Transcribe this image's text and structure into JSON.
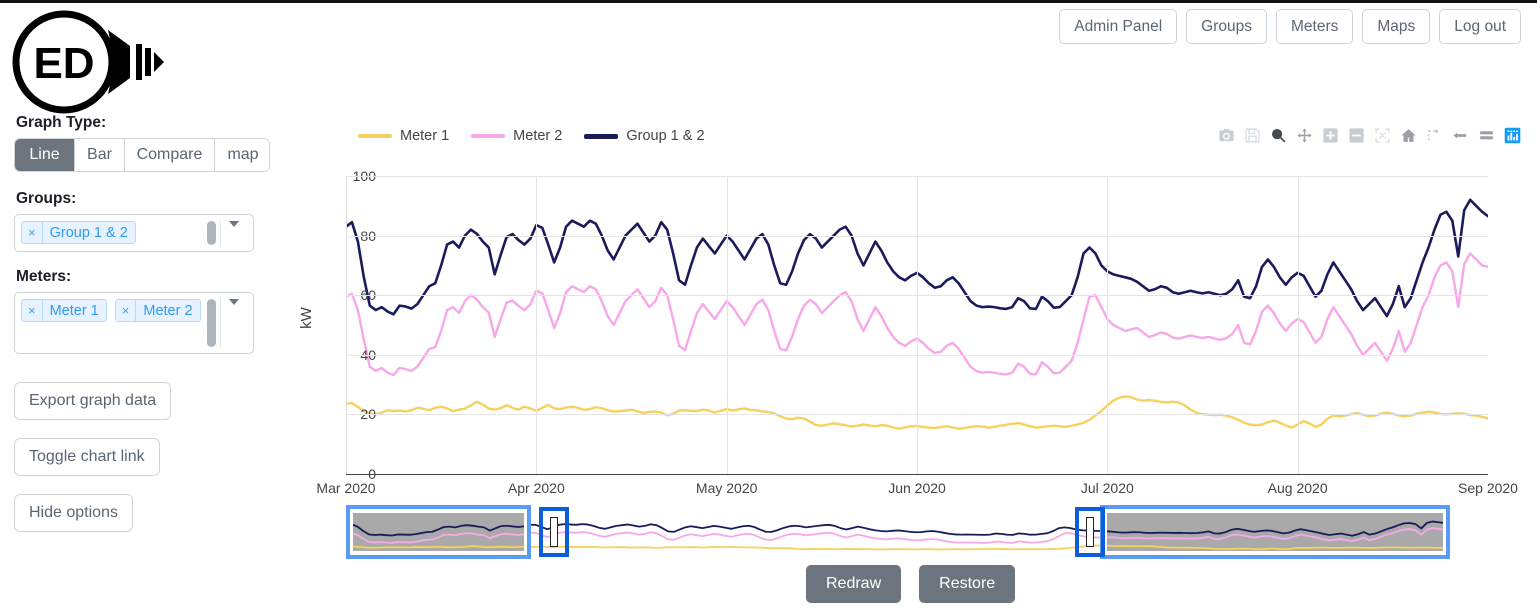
{
  "nav": {
    "buttons": [
      {
        "label": "Admin Panel",
        "name": "admin-panel"
      },
      {
        "label": "Groups",
        "name": "groups"
      },
      {
        "label": "Meters",
        "name": "meters"
      },
      {
        "label": "Maps",
        "name": "maps"
      },
      {
        "label": "Log out",
        "name": "log-out"
      }
    ]
  },
  "logo": {
    "text": "ED"
  },
  "sidebar": {
    "graph_type_label": "Graph Type:",
    "graph_types": [
      {
        "label": "Line",
        "active": true
      },
      {
        "label": "Bar",
        "active": false
      },
      {
        "label": "Compare",
        "active": false
      },
      {
        "label": "map",
        "active": false
      }
    ],
    "groups_label": "Groups:",
    "groups_selected": [
      {
        "label": "Group 1 & 2",
        "remove": "×"
      }
    ],
    "meters_label": "Meters:",
    "meters_selected": [
      {
        "label": "Meter 1",
        "remove": "×"
      },
      {
        "label": "Meter 2",
        "remove": "×"
      }
    ],
    "buttons": [
      {
        "label": "Export graph data",
        "name": "export-graph-data"
      },
      {
        "label": "Toggle chart link",
        "name": "toggle-chart-link"
      },
      {
        "label": "Hide options",
        "name": "hide-options"
      }
    ]
  },
  "modebar": {
    "items": [
      {
        "name": "camera-icon",
        "title": "Download plot as a png",
        "active": false
      },
      {
        "name": "save-disk-icon",
        "title": "Edit in Chart Studio",
        "active": false
      },
      {
        "name": "zoom-icon",
        "title": "Zoom",
        "active": false
      },
      {
        "name": "pan-icon",
        "title": "Pan",
        "active": false
      },
      {
        "name": "zoom-in-icon",
        "title": "Zoom in",
        "active": false
      },
      {
        "name": "zoom-out-icon",
        "title": "Zoom out",
        "active": false
      },
      {
        "name": "autoscale-icon",
        "title": "Autoscale",
        "active": false
      },
      {
        "name": "home-reset-icon",
        "title": "Reset axes",
        "active": false
      },
      {
        "name": "spike-lines-icon",
        "title": "Toggle Spike Lines",
        "active": false
      },
      {
        "name": "hover-closest-icon",
        "title": "Show closest data on hover",
        "active": false
      },
      {
        "name": "hover-compare-icon",
        "title": "Compare data on hover",
        "active": false
      },
      {
        "name": "plotly-logo-icon",
        "title": "Produced with Plotly",
        "active": true
      }
    ],
    "active_color": "#119dff"
  },
  "bottom_buttons": [
    {
      "label": "Redraw",
      "name": "redraw-button"
    },
    {
      "label": "Restore",
      "name": "restore-button"
    }
  ],
  "rangeslider": {
    "selections": [
      {
        "name": "range-selection-left",
        "left_pct": 0.0,
        "width_pct": 16.8
      },
      {
        "name": "range-selection-right",
        "left_pct": 68.3,
        "width_pct": 31.7
      }
    ],
    "handles": [
      {
        "name": "range-handle-left",
        "left_pct": 17.5
      },
      {
        "name": "range-handle-right",
        "left_pct": 66.0
      }
    ],
    "border_color": "#5b9bf8",
    "handle_color": "#0b5ed7",
    "band_color": "#a9a9a9"
  },
  "chart_data": {
    "type": "line",
    "title": "",
    "xlabel": "",
    "ylabel": "kW",
    "ylim": [
      0,
      100
    ],
    "yticks": [
      0,
      20,
      40,
      60,
      80,
      100
    ],
    "xticks": [
      "Mar 2020",
      "Apr 2020",
      "May 2020",
      "Jun 2020",
      "Jul 2020",
      "Aug 2020",
      "Sep 2020"
    ],
    "grid": true,
    "legend_position": "top-left",
    "series": [
      {
        "name": "Meter 1",
        "color": "#f7d060",
        "values": [
          23.5,
          23.8,
          22.5,
          21.2,
          20.3,
          20.0,
          20.6,
          21.4,
          21.1,
          21.3,
          21.0,
          21.4,
          22.2,
          21.9,
          21.4,
          22.2,
          22.6,
          22.0,
          21.1,
          21.6,
          21.9,
          23.0,
          24.2,
          23.3,
          22.0,
          21.6,
          22.1,
          23.1,
          22.2,
          21.6,
          22.6,
          22.0,
          21.2,
          22.2,
          23.2,
          22.0,
          21.8,
          22.3,
          22.6,
          22.2,
          21.5,
          21.8,
          22.4,
          22.1,
          21.4,
          21.0,
          21.1,
          21.3,
          21.6,
          21.0,
          20.5,
          20.8,
          21.0,
          20.6,
          19.7,
          20.2,
          21.3,
          21.4,
          21.2,
          21.1,
          21.6,
          21.3,
          20.6,
          21.2,
          21.8,
          21.3,
          21.7,
          22.0,
          21.5,
          21.4,
          21.0,
          20.8,
          20.3,
          19.4,
          18.6,
          18.4,
          18.9,
          18.6,
          17.6,
          16.4,
          16.2,
          16.6,
          17.0,
          16.7,
          16.4,
          15.9,
          16.2,
          16.6,
          16.3,
          16.0,
          16.4,
          16.2,
          15.6,
          15.2,
          15.6,
          16.0,
          16.1,
          15.8,
          15.6,
          15.4,
          15.8,
          16.0,
          15.6,
          15.2,
          15.4,
          15.8,
          16.0,
          15.9,
          15.6,
          15.8,
          16.2,
          16.5,
          16.8,
          17.1,
          16.6,
          16.0,
          15.6,
          15.8,
          16.0,
          16.2,
          16.0,
          15.8,
          16.2,
          16.6,
          17.2,
          18.2,
          19.6,
          21.2,
          23.0,
          24.6,
          25.6,
          26.0,
          25.8,
          25.0,
          24.6,
          24.8,
          24.6,
          24.2,
          24.0,
          24.2,
          24.0,
          23.0,
          21.6,
          20.5,
          20.1,
          19.9,
          19.8,
          19.9,
          19.6,
          19.0,
          18.2,
          17.2,
          16.6,
          16.4,
          16.6,
          17.4,
          17.9,
          17.2,
          16.3,
          15.6,
          16.6,
          17.8,
          17.0,
          15.8,
          16.6,
          18.6,
          19.6,
          19.4,
          19.6,
          20.1,
          20.4,
          19.9,
          19.4,
          19.6,
          20.2,
          20.6,
          20.2,
          19.6,
          19.4,
          19.6,
          20.2,
          20.6,
          20.9,
          20.6,
          20.2,
          20.0,
          20.2,
          20.4,
          20.2,
          19.8,
          19.6,
          19.2,
          18.6
        ]
      },
      {
        "name": "Meter 2",
        "color": "#f7a8e8",
        "values": [
          59.5,
          60.5,
          55.0,
          45.0,
          36.0,
          34.6,
          35.6,
          34.0,
          33.2,
          35.6,
          35.2,
          34.6,
          36.0,
          39.0,
          42.0,
          42.6,
          48.0,
          55.0,
          56.0,
          54.0,
          58.0,
          60.0,
          58.6,
          56.0,
          54.2,
          46.0,
          52.0,
          57.5,
          58.2,
          56.4,
          55.0,
          57.0,
          61.5,
          60.6,
          55.0,
          49.0,
          54.0,
          61.0,
          63.0,
          62.0,
          61.0,
          63.0,
          62.0,
          58.0,
          53.0,
          50.0,
          54.0,
          58.0,
          60.0,
          62.0,
          59.0,
          56.0,
          58.0,
          62.5,
          60.0,
          52.0,
          43.0,
          41.6,
          48.0,
          54.0,
          57.0,
          54.5,
          52.0,
          55.0,
          58.0,
          56.0,
          53.0,
          50.0,
          53.5,
          57.0,
          58.5,
          55.0,
          48.0,
          42.0,
          41.5,
          46.0,
          52.0,
          56.5,
          58.5,
          57.0,
          54.0,
          56.0,
          58.0,
          60.0,
          61.0,
          58.0,
          52.0,
          48.0,
          52.0,
          56.0,
          53.0,
          49.0,
          46.0,
          44.0,
          43.0,
          44.5,
          45.5,
          44.0,
          42.0,
          40.6,
          41.0,
          43.0,
          44.0,
          42.0,
          39.0,
          36.0,
          34.5,
          34.0,
          34.2,
          34.0,
          33.6,
          33.4,
          34.0,
          37.0,
          36.0,
          33.6,
          33.4,
          37.5,
          36.0,
          33.8,
          34.0,
          36.0,
          38.0,
          44.0,
          52.0,
          59.5,
          60.0,
          56.0,
          52.0,
          50.0,
          49.0,
          48.0,
          48.5,
          49.0,
          47.5,
          46.0,
          46.6,
          47.5,
          47.0,
          45.8,
          45.4,
          46.0,
          46.5,
          46.0,
          45.6,
          46.0,
          45.5,
          45.0,
          45.6,
          47.0,
          50.0,
          44.0,
          43.5,
          48.0,
          54.5,
          56.5,
          54.0,
          50.5,
          48.0,
          50.5,
          52.0,
          51.0,
          47.5,
          44.0,
          46.0,
          52.0,
          56.0,
          53.0,
          50.0,
          47.0,
          43.0,
          40.0,
          42.0,
          44.0,
          41.0,
          38.0,
          42.0,
          48.0,
          41.0,
          44.0,
          50.0,
          56.0,
          60.0,
          66.0,
          70.0,
          71.0,
          68.0,
          56.0,
          70.5,
          74.0,
          72.0,
          70.0,
          69.5
        ]
      },
      {
        "name": "Group 1 & 2",
        "color": "#1b1b5c",
        "values": [
          83.0,
          84.5,
          78.0,
          66.0,
          56.5,
          55.0,
          56.0,
          54.5,
          53.6,
          56.5,
          56.2,
          55.5,
          57.0,
          60.0,
          63.0,
          64.0,
          70.0,
          77.0,
          78.0,
          76.0,
          80.0,
          82.0,
          80.6,
          78.0,
          76.0,
          67.0,
          73.5,
          79.5,
          80.5,
          78.5,
          77.0,
          79.0,
          83.5,
          82.6,
          77.0,
          71.0,
          76.0,
          83.0,
          85.0,
          84.0,
          83.0,
          85.0,
          84.0,
          80.0,
          75.0,
          72.0,
          76.0,
          80.0,
          82.0,
          84.0,
          81.0,
          78.0,
          80.0,
          84.5,
          82.0,
          74.0,
          65.0,
          63.5,
          70.0,
          76.0,
          79.0,
          76.5,
          74.0,
          77.0,
          80.0,
          78.0,
          75.0,
          72.0,
          75.5,
          79.0,
          80.5,
          77.0,
          70.0,
          64.0,
          63.5,
          68.0,
          74.0,
          78.5,
          80.5,
          79.0,
          76.0,
          78.0,
          80.0,
          82.0,
          83.0,
          80.0,
          74.0,
          70.0,
          74.0,
          78.0,
          75.0,
          71.0,
          68.0,
          66.0,
          65.0,
          66.5,
          67.5,
          66.0,
          64.0,
          62.5,
          63.0,
          65.0,
          66.0,
          64.0,
          61.0,
          58.0,
          56.5,
          56.0,
          56.2,
          56.0,
          55.6,
          55.4,
          56.0,
          59.0,
          58.0,
          55.6,
          55.4,
          59.5,
          58.0,
          55.8,
          56.0,
          58.0,
          60.0,
          66.0,
          74.0,
          76.0,
          74.0,
          70.0,
          68.0,
          67.0,
          66.5,
          66.0,
          65.5,
          64.5,
          63.0,
          61.5,
          62.0,
          63.0,
          62.5,
          61.0,
          60.5,
          61.0,
          61.5,
          61.0,
          60.6,
          61.0,
          60.5,
          60.0,
          60.5,
          62.0,
          65.0,
          59.5,
          59.0,
          63.0,
          69.5,
          72.0,
          69.5,
          66.0,
          63.5,
          66.0,
          67.5,
          66.5,
          63.0,
          59.5,
          61.5,
          67.0,
          71.0,
          68.0,
          65.0,
          62.0,
          58.0,
          55.0,
          57.0,
          59.0,
          56.0,
          53.0,
          57.0,
          63.0,
          56.0,
          59.0,
          65.0,
          71.0,
          76.0,
          82.0,
          87.0,
          88.0,
          85.0,
          73.0,
          88.5,
          92.0,
          90.0,
          88.0,
          86.5
        ]
      }
    ]
  }
}
